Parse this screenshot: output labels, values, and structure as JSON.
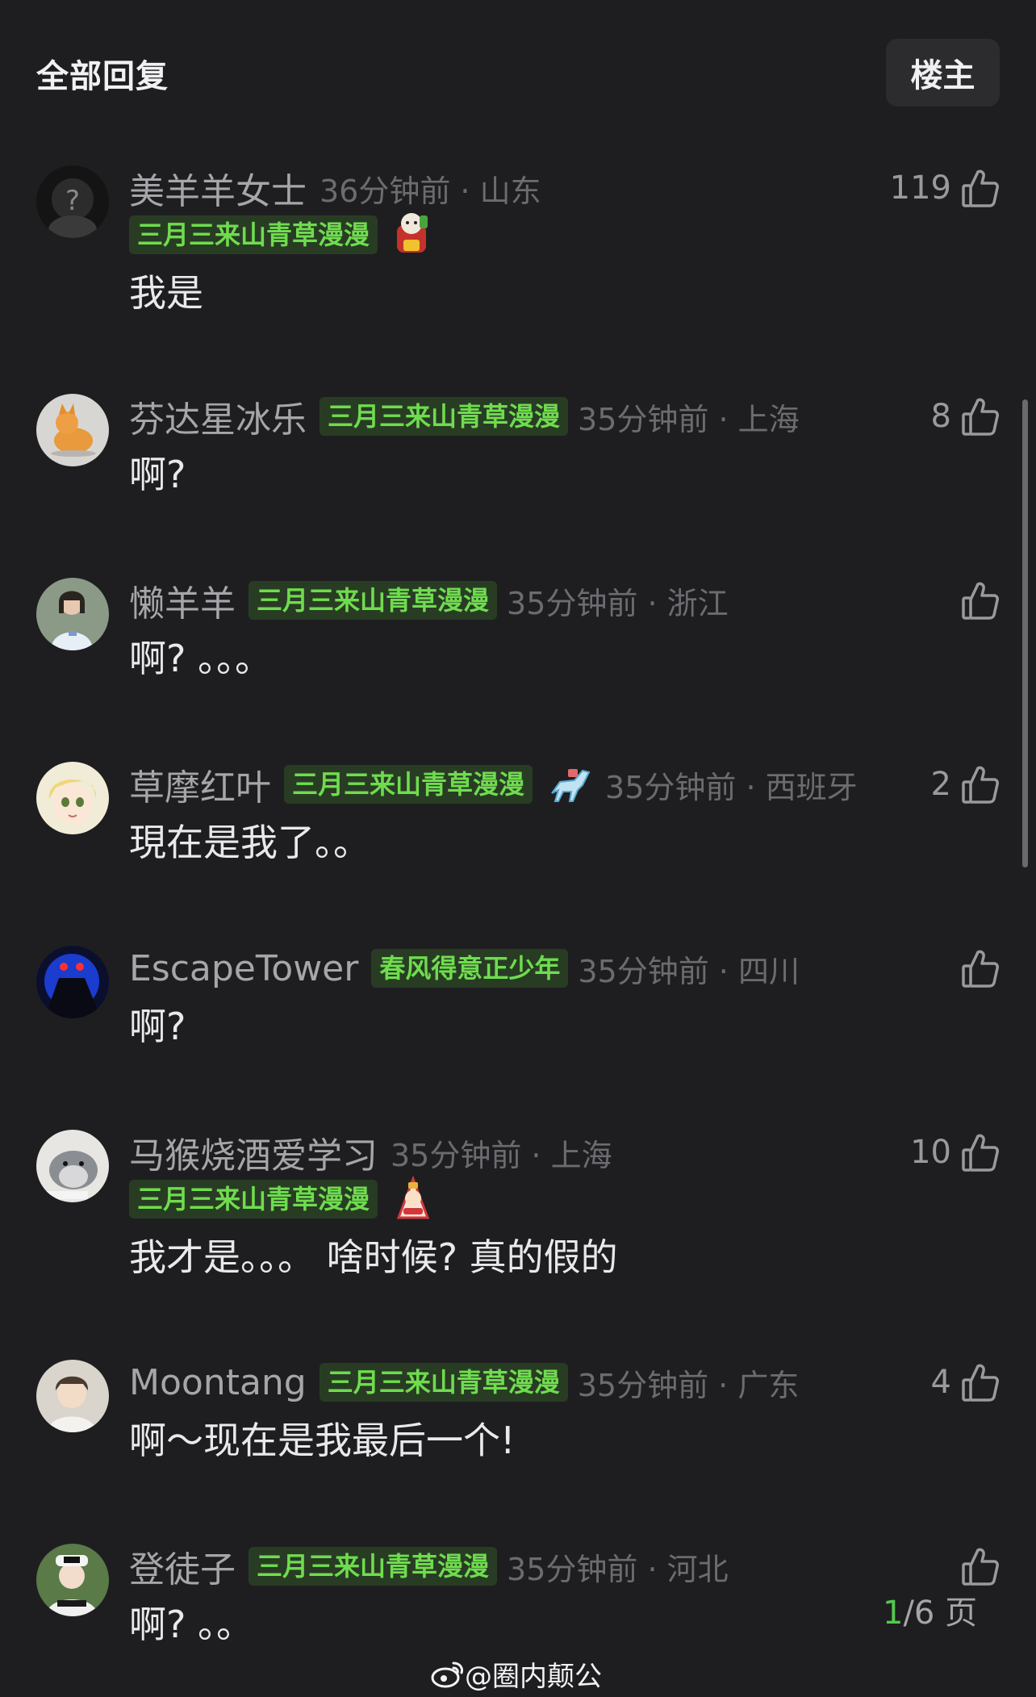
{
  "header": {
    "title": "全部回复",
    "op_button": "楼主"
  },
  "comments": [
    {
      "username": "美羊羊女士",
      "badge": "三月三来山青草漫漫",
      "time": "36分钟前 · 山东",
      "text": "我是",
      "likes": "119"
    },
    {
      "username": "芬达星冰乐",
      "badge": "三月三来山青草漫漫",
      "time": "35分钟前 · 上海",
      "text": "啊?",
      "likes": "8"
    },
    {
      "username": "懒羊羊",
      "badge": "三月三来山青草漫漫",
      "time": "35分钟前 · 浙江",
      "text": "啊? 。。。",
      "likes": ""
    },
    {
      "username": "草摩红叶",
      "badge": "三月三来山青草漫漫",
      "time": "35分钟前 · 西班牙",
      "text": "現在是我了。。",
      "likes": "2"
    },
    {
      "username": "EscapeTower",
      "badge": "春风得意正少年",
      "time": "35分钟前 · 四川",
      "text": "啊?",
      "likes": ""
    },
    {
      "username": "马猴烧酒爱学习",
      "badge": "三月三来山青草漫漫",
      "time": "35分钟前 · 上海",
      "text": "我才是。。。 啥时候? 真的假的",
      "likes": "10"
    },
    {
      "username": "Moontang",
      "badge": "三月三来山青草漫漫",
      "time": "35分钟前 · 广东",
      "text": "啊～现在是我最后一个!",
      "likes": "4"
    },
    {
      "username": "登徒子",
      "badge": "三月三来山青草漫漫",
      "time": "35分钟前 · 河北",
      "text": "啊? 。。",
      "likes": ""
    }
  ],
  "pager": {
    "current": "1",
    "rest": "/6 页"
  },
  "watermark": {
    "text": "@圈内颠公"
  },
  "colors": {
    "background": "#1e1e20",
    "badge_text": "#6fdc4e",
    "badge_bg": "#283c24",
    "username": "#a6a6aa",
    "meta": "#6b6b70"
  },
  "icons": {
    "like": "thumbs-up-icon",
    "weibo": "weibo-logo-icon"
  }
}
